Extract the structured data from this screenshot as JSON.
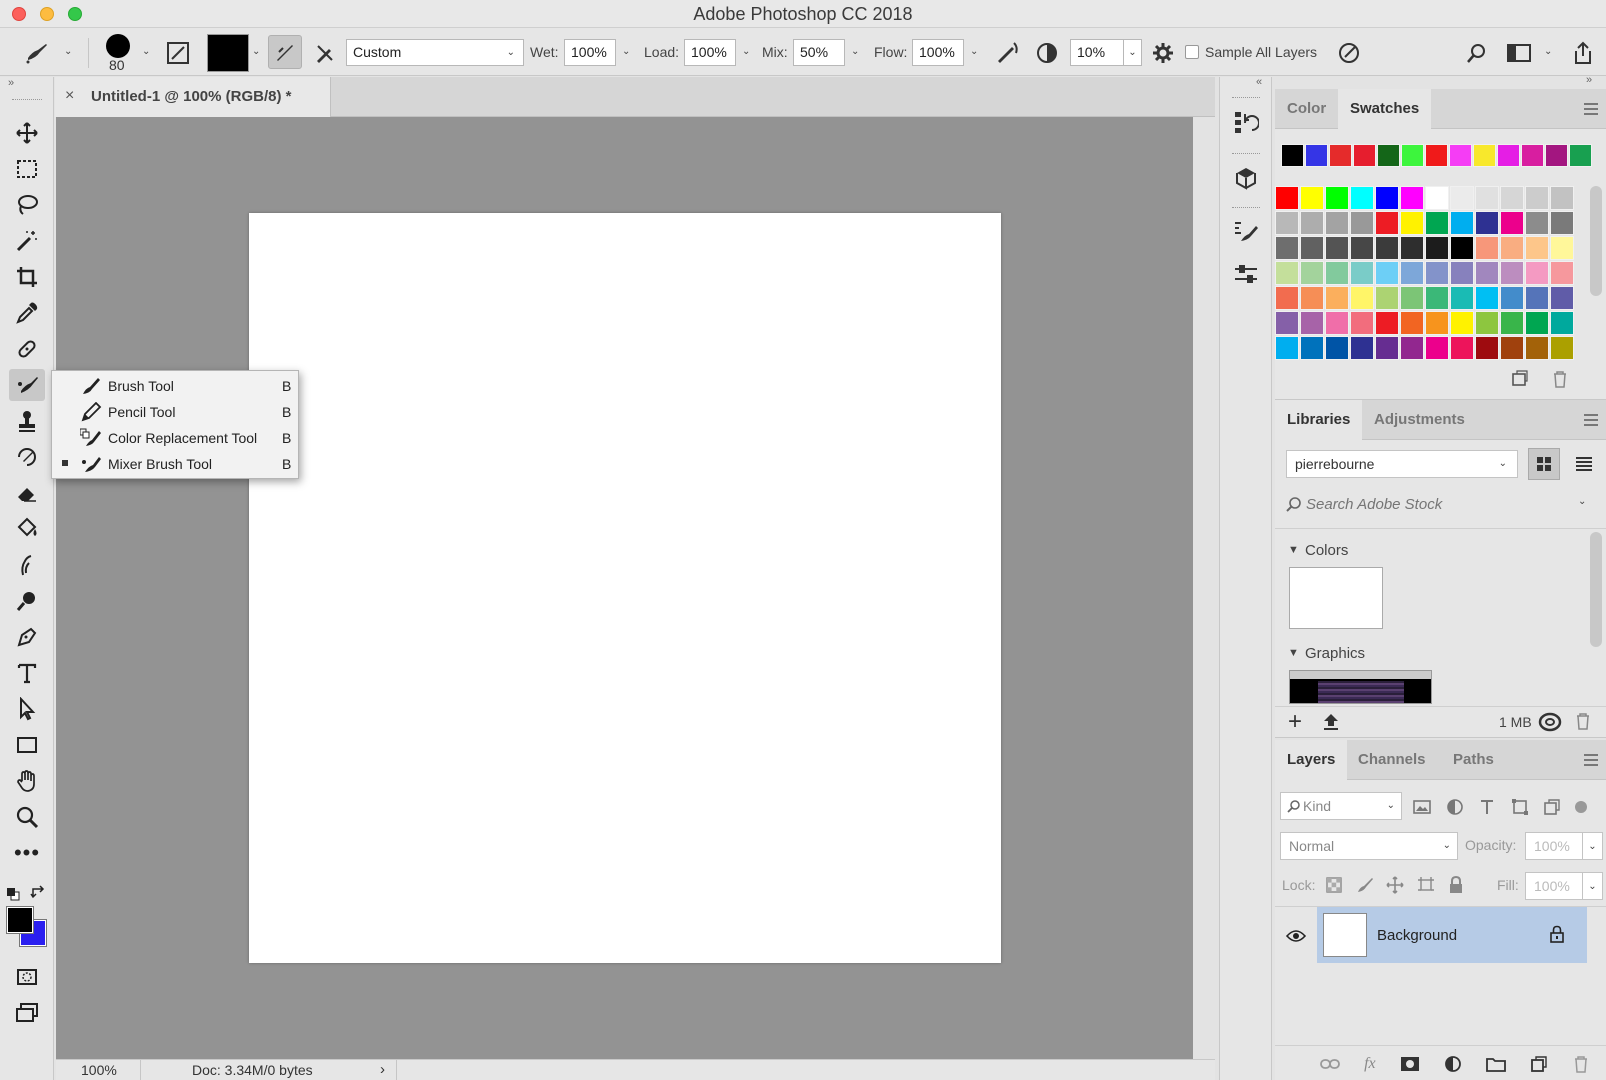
{
  "window": {
    "title": "Adobe Photoshop CC 2018"
  },
  "options": {
    "brush_size": "80",
    "mode": "Custom",
    "wet_label": "Wet:",
    "wet": "100%",
    "load_label": "Load:",
    "load": "100%",
    "mix_label": "Mix:",
    "mix": "50%",
    "flow_label": "Flow:",
    "flow": "100%",
    "smoothing": "10%",
    "sample_all_layers": "Sample All Layers"
  },
  "document": {
    "tab_title": "Untitled-1 @ 100% (RGB/8) *",
    "zoom": "100%",
    "doc_info": "Doc: 3.34M/0 bytes"
  },
  "flyout": [
    {
      "label": "Brush Tool",
      "key": "B",
      "icon": "brush-icon",
      "selected": false
    },
    {
      "label": "Pencil Tool",
      "key": "B",
      "icon": "pencil-icon",
      "selected": false
    },
    {
      "label": "Color Replacement Tool",
      "key": "B",
      "icon": "color-replacement-icon",
      "selected": false
    },
    {
      "label": "Mixer Brush Tool",
      "key": "B",
      "icon": "mixer-brush-icon",
      "selected": true
    }
  ],
  "swatches_panel": {
    "tabs": [
      "Color",
      "Swatches"
    ],
    "active_tab": "Swatches",
    "recent": [
      "#000000",
      "#3535e6",
      "#e52b2b",
      "#e61e2e",
      "#146618",
      "#3df53d",
      "#f01a1a",
      "#f53df5",
      "#f8e82c",
      "#e51ee5",
      "#d81ea0",
      "#a31680",
      "#18a050"
    ],
    "grid": [
      [
        "#ff0000",
        "#ffff00",
        "#00ff00",
        "#00ffff",
        "#0000ff",
        "#ff00ff",
        "#ffffff",
        "#ebebeb",
        "#e0e0e0",
        "#d6d6d6",
        "#cccccc",
        "#c2c2c2"
      ],
      [
        "#b8b8b8",
        "#adadad",
        "#a3a3a3",
        "#999999",
        "#ed1c24",
        "#fff200",
        "#00a651",
        "#00aeef",
        "#2e3192",
        "#ec008c",
        "#8c8c8c",
        "#7a7a7a"
      ],
      [
        "#6e6e6e",
        "#616161",
        "#545454",
        "#474747",
        "#3b3b3b",
        "#2e2e2e",
        "#1c1c1c",
        "#000000",
        "#f7977a",
        "#f9ad81",
        "#fdc68a",
        "#fff79a"
      ],
      [
        "#c4df9b",
        "#a3d39c",
        "#82ca9d",
        "#7accc8",
        "#6dcff6",
        "#7da7d9",
        "#8393ca",
        "#8781bd",
        "#a187be",
        "#bc8dbf",
        "#f49ac2",
        "#f6989d"
      ],
      [
        "#f26c4f",
        "#f68e56",
        "#fbaf5d",
        "#fff568",
        "#acd372",
        "#7cc576",
        "#3bb878",
        "#1abbb4",
        "#00bff3",
        "#438ccb",
        "#5574b9",
        "#605ca8"
      ],
      [
        "#8560a8",
        "#a763a8",
        "#f06ea9",
        "#f26d7d",
        "#ed1c24",
        "#f26522",
        "#f7941d",
        "#fff200",
        "#8dc63f",
        "#39b54a",
        "#00a651",
        "#00a99d"
      ],
      [
        "#00aeef",
        "#0072bc",
        "#0054a6",
        "#2e3192",
        "#662d91",
        "#92278f",
        "#ec008c",
        "#ed145b",
        "#9e0b0f",
        "#a0410d",
        "#a36209",
        "#aba000"
      ]
    ]
  },
  "libraries_panel": {
    "tabs": [
      "Libraries",
      "Adjustments"
    ],
    "active_tab": "Libraries",
    "library": "pierrebourne",
    "search_placeholder": "Search Adobe Stock",
    "colors_label": "Colors",
    "graphics_label": "Graphics",
    "size": "1 MB"
  },
  "layers_panel": {
    "tabs": [
      "Layers",
      "Channels",
      "Paths"
    ],
    "active_tab": "Layers",
    "kind": "Kind",
    "blend_mode": "Normal",
    "opacity_label": "Opacity:",
    "opacity": "100%",
    "lock_label": "Lock:",
    "fill_label": "Fill:",
    "fill": "100%",
    "layers": [
      {
        "name": "Background",
        "visible": true,
        "locked": true
      }
    ]
  },
  "colors": {
    "foreground": "#000000",
    "background": "#2a1ff0",
    "layer_selected": "#b6cbe6"
  }
}
